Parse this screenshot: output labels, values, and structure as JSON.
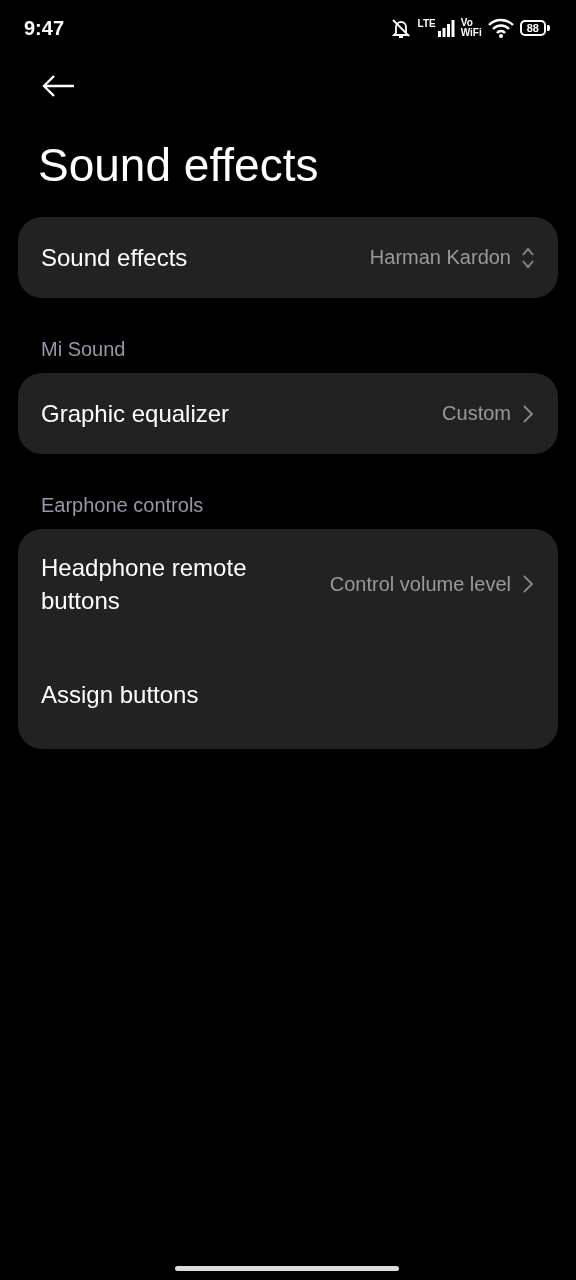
{
  "status_bar": {
    "time": "9:47",
    "network": "LTE",
    "volte_top": "Vo",
    "volte_bottom": "WiFi",
    "battery": "88"
  },
  "title": "Sound effects",
  "groups": [
    {
      "items": [
        {
          "kind": "dropdown",
          "label": "Sound effects",
          "value": "Harman Kardon"
        }
      ]
    },
    {
      "header": "Mi Sound",
      "items": [
        {
          "kind": "link",
          "label": "Graphic equalizer",
          "value": "Custom"
        }
      ]
    },
    {
      "header": "Earphone controls",
      "items": [
        {
          "kind": "link",
          "label": "Headphone remote buttons",
          "value": "Control volume level"
        },
        {
          "kind": "plain",
          "label": "Assign buttons"
        }
      ]
    }
  ]
}
